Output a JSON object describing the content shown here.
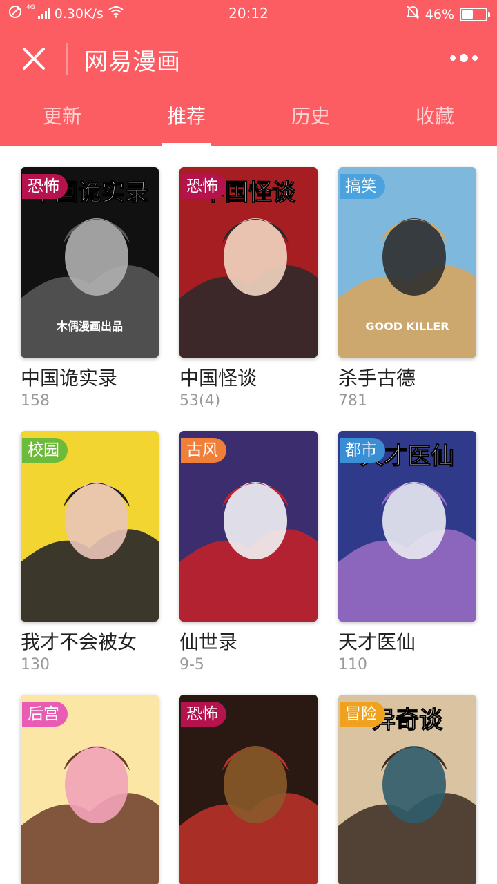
{
  "status": {
    "net_small": "4G",
    "speed": "0.30K/s",
    "time": "20:12",
    "battery": "46%",
    "battery_level": 0.46
  },
  "header": {
    "title": "网易漫画"
  },
  "tabs": [
    {
      "label": "更新"
    },
    {
      "label": "推荐",
      "active": true
    },
    {
      "label": "历史"
    },
    {
      "label": "收藏"
    }
  ],
  "comics": [
    {
      "name": "中国诡实录",
      "count": "158",
      "tag": "恐怖",
      "tag_color": "#b4134d",
      "cover_title": "中国诡实录",
      "cover_sub": "木偶漫画出品",
      "cover_colors": [
        "#111111",
        "#5b5b5b",
        "#b0b0b0"
      ]
    },
    {
      "name": "中国怪谈",
      "count": "53(4)",
      "tag": "恐怖",
      "tag_color": "#b4134d",
      "cover_title": "中国怪谈",
      "cover_sub": "",
      "cover_colors": [
        "#a61d22",
        "#2a2a2a",
        "#f1d5c0"
      ]
    },
    {
      "name": "杀手古德",
      "count": "781",
      "tag": "搞笑",
      "tag_color": "#4aa3df",
      "cover_title": "",
      "cover_sub": "GOOD KILLER",
      "cover_colors": [
        "#7fb8dd",
        "#d9a55a",
        "#2f2f2f"
      ]
    },
    {
      "name": "我才不会被女",
      "count": "130",
      "tag": "校园",
      "tag_color": "#6dbb3a",
      "cover_title": "",
      "cover_sub": "",
      "cover_colors": [
        "#f3d531",
        "#1b1b2a",
        "#e9c5b8"
      ]
    },
    {
      "name": "仙世录",
      "count": "9-5",
      "tag": "古风",
      "tag_color": "#f07f3a",
      "cover_title": "",
      "cover_sub": "",
      "cover_colors": [
        "#3b2d6e",
        "#c82127",
        "#f2f2f5"
      ]
    },
    {
      "name": "天才医仙",
      "count": "110",
      "tag": "都市",
      "tag_color": "#3a8fd4",
      "cover_title": "天才医仙",
      "cover_sub": "",
      "cover_colors": [
        "#303a8a",
        "#9b6fc4",
        "#e9e9f1"
      ]
    },
    {
      "name": "",
      "count": "",
      "tag": "后宫",
      "tag_color": "#e85cb4",
      "cover_title": "",
      "cover_sub": "",
      "cover_colors": [
        "#fbe6a6",
        "#6b3c2a",
        "#f2a3b9"
      ]
    },
    {
      "name": "",
      "count": "",
      "tag": "恐怖",
      "tag_color": "#b4134d",
      "cover_title": "",
      "cover_sub": "",
      "cover_colors": [
        "#2a1812",
        "#c0322a",
        "#8a5a2a"
      ]
    },
    {
      "name": "",
      "count": "",
      "tag": "冒险",
      "tag_color": "#f0a21e",
      "cover_title": "异奇谈",
      "cover_sub": "",
      "cover_colors": [
        "#d9c3a0",
        "#3a2a22",
        "#2f5d6b"
      ]
    }
  ]
}
